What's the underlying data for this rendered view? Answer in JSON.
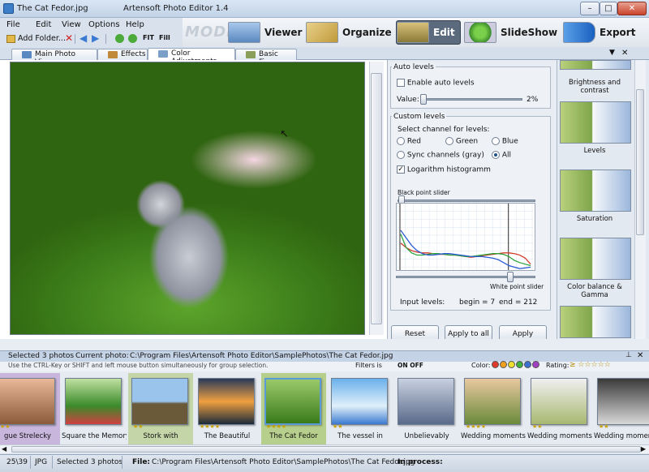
{
  "window": {
    "filename": "The Cat Fedor.jpg",
    "app_title": "Artensoft Photo Editor 1.4",
    "minimize": "–",
    "maximize": "□",
    "close": "✕"
  },
  "menu": {
    "file": "File",
    "edit": "Edit",
    "view": "View",
    "options": "Options",
    "help": "Help"
  },
  "toolbar": {
    "add_folder": "Add Folder...",
    "fit": "FIT",
    "fill": "Fill"
  },
  "mode": {
    "label": "MODE:",
    "buttons": [
      {
        "label": "Viewer",
        "icon": "viewer-icon"
      },
      {
        "label": "Organize",
        "icon": "organize-icon"
      },
      {
        "label": "Edit",
        "icon": "edit-icon",
        "active": true
      },
      {
        "label": "SlideShow",
        "icon": "slideshow-icon"
      },
      {
        "label": "Export",
        "icon": "export-icon"
      }
    ]
  },
  "tabs": [
    {
      "label": "Main Photo View"
    },
    {
      "label": "Effects"
    },
    {
      "label": "Color Adjustments",
      "active": true
    },
    {
      "label": "Basic Fixes"
    }
  ],
  "tab_controls": {
    "dropdown": "▼",
    "close": "✕"
  },
  "auto_levels": {
    "title": "Auto levels",
    "enable_label": "Enable auto levels",
    "enabled": false,
    "value_label": "Value:",
    "value": "2%"
  },
  "custom_levels": {
    "title": "Custom levels",
    "channel_prompt": "Select channel for levels:",
    "channels": {
      "red": "Red",
      "green": "Green",
      "blue": "Blue",
      "sync": "Sync channels (gray)",
      "all": "All"
    },
    "selected_channel": "All",
    "log_histogram_label": "Logarithm histogramm",
    "log_histogram_checked": true,
    "black_point_label": "Black point slider",
    "white_point_label": "White point slider",
    "input_levels_label": "Input levels:",
    "begin": "begin = 7",
    "end": "end = 212"
  },
  "buttons": {
    "reset": "Reset",
    "apply_to_all": "Apply to all",
    "apply": "Apply"
  },
  "presets": [
    {
      "label": "Brightness and contrast"
    },
    {
      "label": "Levels"
    },
    {
      "label": "Saturation"
    },
    {
      "label": "Color balance & Gamma"
    },
    {
      "label": ""
    }
  ],
  "info": {
    "selected": "Selected 3  photos",
    "current_label": "Current photo:",
    "current_path": "C:\\Program Files\\Artensoft Photo Editor\\SamplePhotos\\The Cat Fedor.jpg",
    "hint": "Use the CTRL-Key or SHIFT and  left mouse button simultaneously for group selection.",
    "filters_label": "Filters is",
    "filters_state": "ON OFF",
    "color_label": "Color:",
    "rating_label": "Rating:",
    "rating_value": "≥ ☆☆☆☆☆"
  },
  "colors": {
    "swatches": [
      "#e03a2a",
      "#f0a020",
      "#f0e030",
      "#40b040",
      "#3a70d0",
      "#a040c0"
    ],
    "accent_active": "#b7cf8c"
  },
  "gallery": [
    {
      "caption": "gue Strelecky",
      "stars": "★★",
      "selected": true
    },
    {
      "caption": "Square the Memory",
      "stars": ""
    },
    {
      "caption": "Stork with",
      "stars": "★★",
      "selected": true
    },
    {
      "caption": "The Beautiful",
      "stars": "★★★★"
    },
    {
      "caption": "The Cat Fedor",
      "stars": "★★★★",
      "selected": true,
      "current": true
    },
    {
      "caption": "The vessel in",
      "stars": "★★"
    },
    {
      "caption": "Unbelievably",
      "stars": ""
    },
    {
      "caption": "Wedding moments",
      "stars": "★★★★"
    },
    {
      "caption": "Wedding moments",
      "stars": "★★"
    },
    {
      "caption": "Wedding moments",
      "stars": "★★"
    }
  ],
  "status": {
    "index": "25\\39",
    "format": "JPG",
    "selected": "Selected 3 photos",
    "file_label": "File:",
    "file_path": "C:\\Program Files\\Artensoft Photo Editor\\SamplePhotos\\The Cat Fedor.jpg",
    "process_label": "In process:"
  },
  "histogram": {
    "red": [
      42,
      48,
      52,
      54,
      55,
      55,
      56,
      57,
      57,
      58,
      58,
      59,
      60,
      61,
      60,
      59,
      58,
      57,
      56,
      55,
      55,
      56,
      58,
      62,
      70
    ],
    "green": [
      30,
      48,
      55,
      58,
      58,
      57,
      56,
      56,
      57,
      58,
      58,
      59,
      60,
      60,
      59,
      58,
      57,
      56,
      56,
      57,
      60,
      65,
      68,
      70,
      72
    ],
    "blue": [
      25,
      35,
      45,
      52,
      56,
      58,
      58,
      57,
      56,
      56,
      57,
      58,
      59,
      60,
      60,
      60,
      61,
      62,
      64,
      68,
      72,
      74,
      76,
      75,
      74
    ]
  }
}
